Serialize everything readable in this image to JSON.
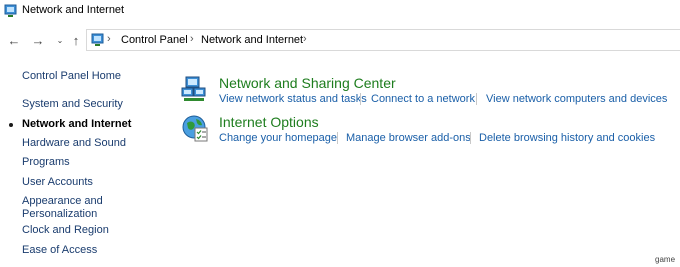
{
  "window": {
    "title": "Network and Internet"
  },
  "nav": {
    "back_icon": "arrow-left",
    "forward_icon": "arrow-right",
    "recent_icon": "chevron-down",
    "up_icon": "arrow-up"
  },
  "breadcrumb": [
    "Control Panel",
    "Network and Internet"
  ],
  "sidebar": {
    "items": [
      {
        "label": "Control Panel Home",
        "active": false
      },
      {
        "label": "System and Security",
        "active": false
      },
      {
        "label": "Network and Internet",
        "active": true
      },
      {
        "label": "Hardware and Sound",
        "active": false
      },
      {
        "label": "Programs",
        "active": false
      },
      {
        "label": "User Accounts",
        "active": false
      },
      {
        "label": "Appearance and",
        "active": false
      },
      {
        "label": "Personalization",
        "active": false
      },
      {
        "label": "Clock and Region",
        "active": false
      },
      {
        "label": "Ease of Access",
        "active": false
      }
    ]
  },
  "categories": [
    {
      "title": "Network and Sharing Center",
      "icon": "network-icon",
      "links": [
        "View network status and tasks",
        "Connect to a network",
        "View network computers and devices"
      ]
    },
    {
      "title": "Internet Options",
      "icon": "internet-options-icon",
      "links": [
        "Change your homepage",
        "Manage browser add-ons",
        "Delete browsing history and cookies"
      ]
    }
  ],
  "watermark": "game",
  "colors": {
    "category_title": "#1e7d1e",
    "link": "#1a5fa8",
    "sidebar_link": "#1a3c6e"
  }
}
